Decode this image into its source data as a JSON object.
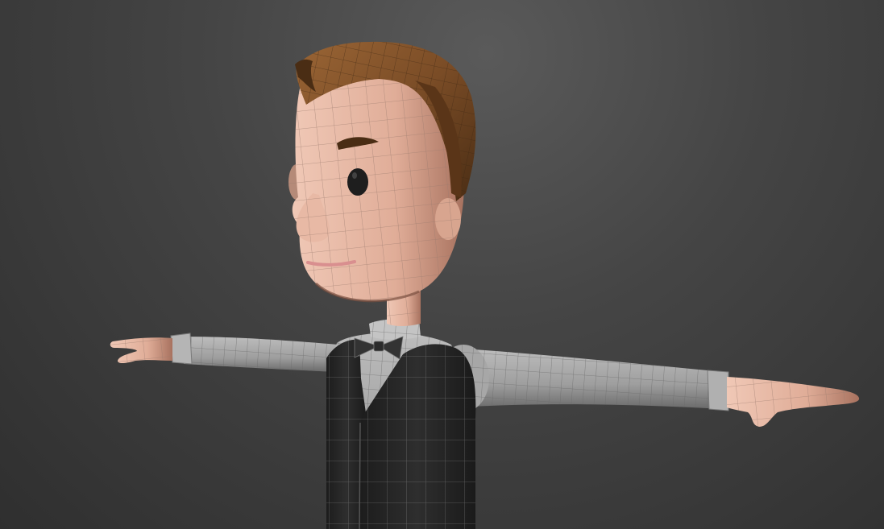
{
  "viewport": {
    "background_top": "#5a5a5a",
    "background_bottom": "#2f2f2f",
    "view": "perspective"
  },
  "scene": {
    "model": "cartoon-character",
    "pose": "T-pose",
    "display_mode": "shaded-with-wireframe",
    "wire_color": "#8a8a8a",
    "colors": {
      "skin": "#e2b39f",
      "skin_shadow": "#9b6d5c",
      "hair": "#6e4423",
      "hair_highlight": "#9a6535",
      "shirt": "#a9a9a9",
      "shirt_shadow": "#6d6d6d",
      "vest": "#2a2a2a",
      "bowtie": "#3a3a3a",
      "eye": "#1e1e1e",
      "lip": "#d98f8f"
    }
  }
}
